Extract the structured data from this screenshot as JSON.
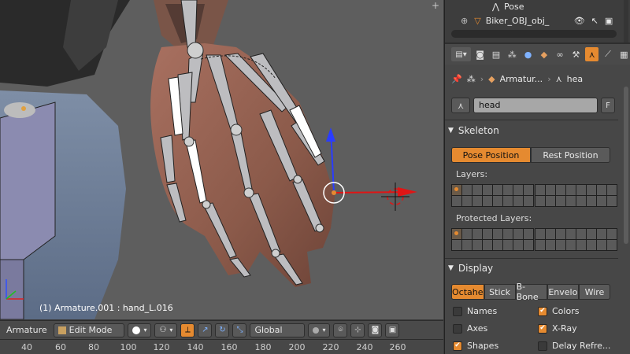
{
  "viewport": {
    "info": "(1) Armature.001 : hand_L.016"
  },
  "header": {
    "editor": "Armature",
    "mode": "Edit Mode",
    "orientation": "Global"
  },
  "ruler": {
    "ticks": [
      "40",
      "60",
      "80",
      "100",
      "120",
      "140",
      "160",
      "180",
      "200",
      "220",
      "240",
      "260"
    ]
  },
  "outliner": {
    "row1": "Pose",
    "row2": "Biker_OBJ_obj_"
  },
  "properties": {
    "breadcrumb_object": "Armatur...",
    "breadcrumb_bone": "hea",
    "name_value": "head",
    "name_suffix": "F",
    "skeleton": {
      "title": "Skeleton",
      "pose_position": "Pose Position",
      "rest_position": "Rest Position",
      "layers_label": "Layers:",
      "protected_label": "Protected Layers:"
    },
    "display": {
      "title": "Display",
      "draw_types": [
        "Octahe",
        "Stick",
        "B-Bone",
        "Envelo",
        "Wire"
      ],
      "names": "Names",
      "colors": "Colors",
      "axes": "Axes",
      "xray": "X-Ray",
      "shapes": "Shapes",
      "delay": "Delay Refre..."
    }
  },
  "colors": {
    "accent": "#e58a30",
    "background": "#474747"
  }
}
